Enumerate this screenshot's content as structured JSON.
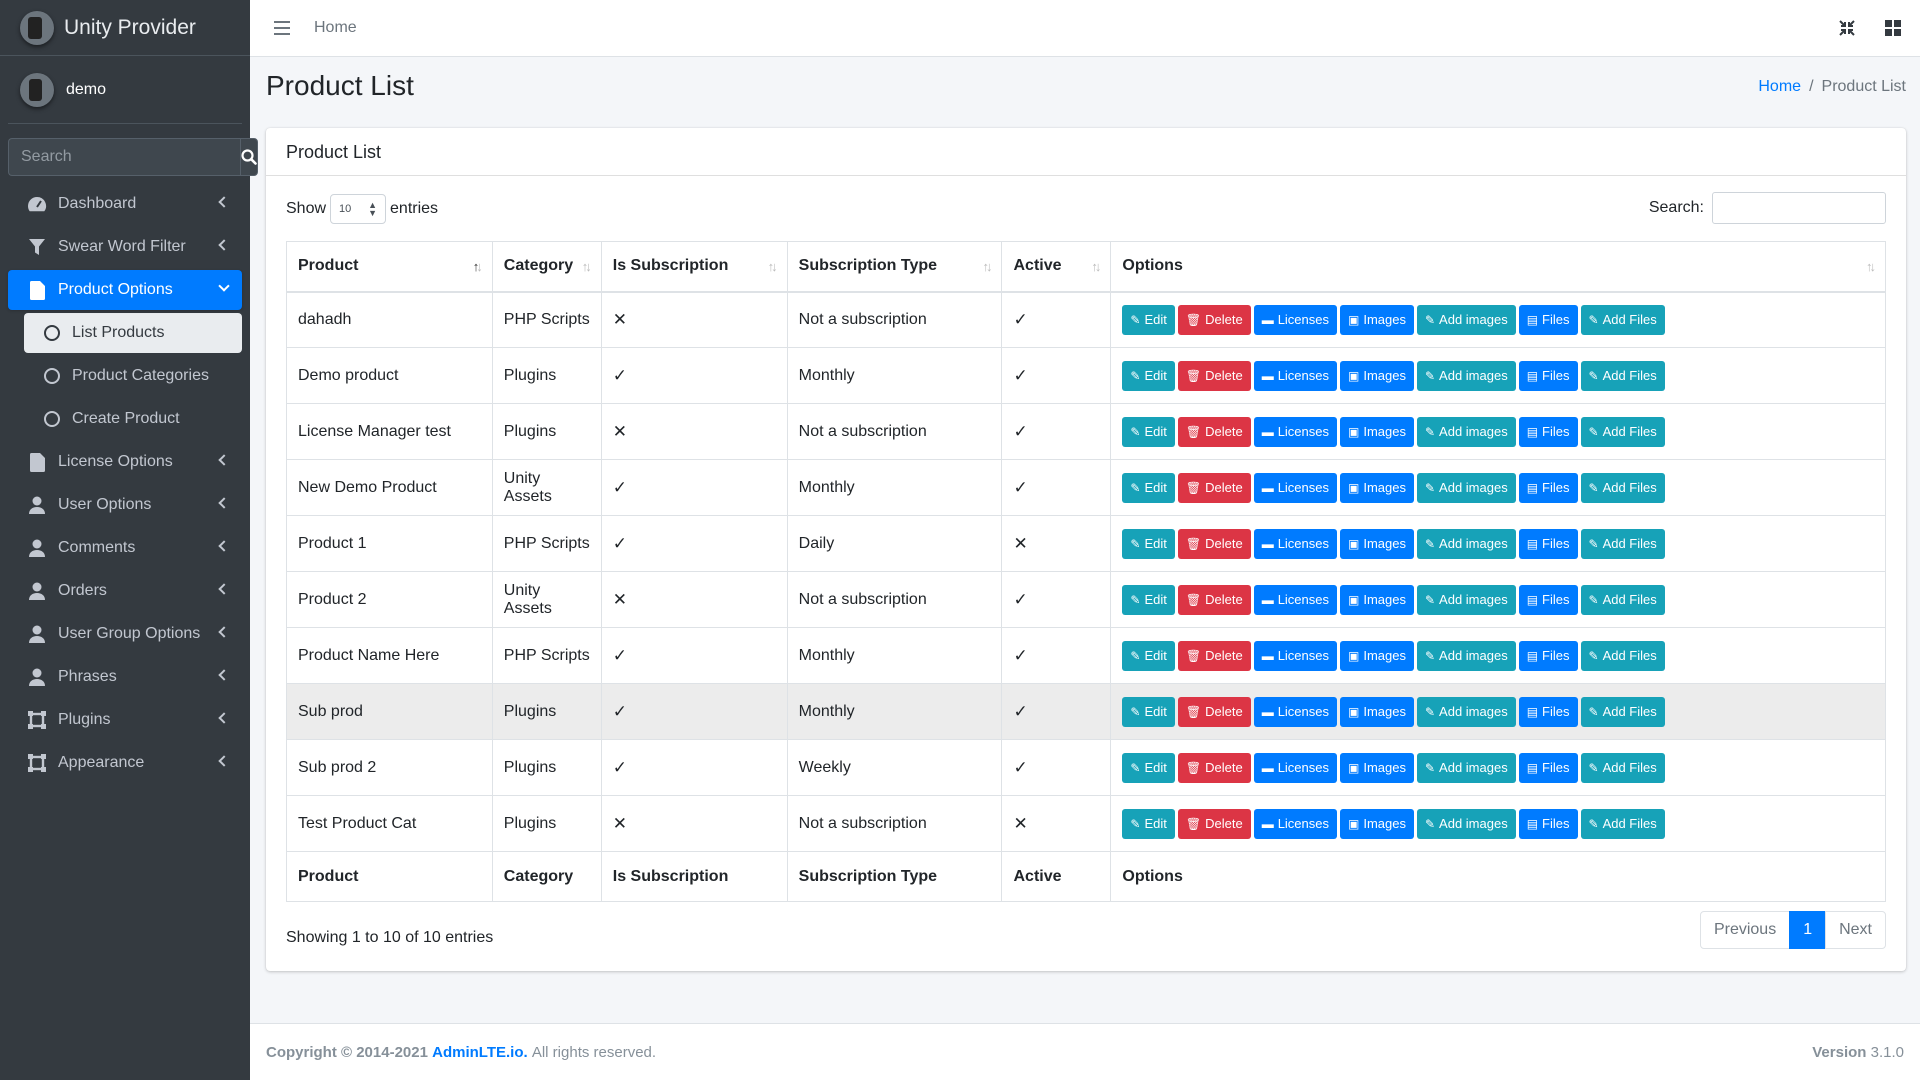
{
  "brand": {
    "name": "Unity Provider"
  },
  "user": {
    "name": "demo"
  },
  "sidebar_search": {
    "placeholder": "Search"
  },
  "nav": {
    "dashboard": "Dashboard",
    "swear_word_filter": "Swear Word Filter",
    "product_options": "Product Options",
    "list_products": "List Products",
    "product_categories": "Product Categories",
    "create_product": "Create Product",
    "license_options": "License Options",
    "user_options": "User Options",
    "comments": "Comments",
    "orders": "Orders",
    "user_group_options": "User Group Options",
    "phrases": "Phrases",
    "plugins": "Plugins",
    "appearance": "Appearance"
  },
  "topbar": {
    "home": "Home"
  },
  "header": {
    "title": "Product List",
    "breadcrumb_home": "Home",
    "breadcrumb_current": "Product List"
  },
  "card": {
    "title": "Product List"
  },
  "controls": {
    "show": "Show",
    "length": "10",
    "entries": "entries",
    "search_label": "Search:"
  },
  "columns": [
    "Product",
    "Category",
    "Is Subscription",
    "Subscription Type",
    "Active",
    "Options"
  ],
  "actions": {
    "edit": "Edit",
    "delete": "Delete",
    "licenses": "Licenses",
    "images": "Images",
    "add_images": "Add images",
    "files": "Files",
    "add_files": "Add Files"
  },
  "rows": [
    {
      "product": "dahadh",
      "category": "PHP Scripts",
      "is_subscription": "✕",
      "subscription_type": "Not a subscription",
      "active": "✓"
    },
    {
      "product": "Demo product",
      "category": "Plugins",
      "is_subscription": "✓",
      "subscription_type": "Monthly",
      "active": "✓"
    },
    {
      "product": "License Manager test",
      "category": "Plugins",
      "is_subscription": "✕",
      "subscription_type": "Not a subscription",
      "active": "✓"
    },
    {
      "product": "New Demo Product",
      "category": "Unity Assets",
      "is_subscription": "✓",
      "subscription_type": "Monthly",
      "active": "✓"
    },
    {
      "product": "Product 1",
      "category": "PHP Scripts",
      "is_subscription": "✓",
      "subscription_type": "Daily",
      "active": "✕"
    },
    {
      "product": "Product 2",
      "category": "Unity Assets",
      "is_subscription": "✕",
      "subscription_type": "Not a subscription",
      "active": "✓"
    },
    {
      "product": "Product Name Here",
      "category": "PHP Scripts",
      "is_subscription": "✓",
      "subscription_type": "Monthly",
      "active": "✓"
    },
    {
      "product": "Sub prod",
      "category": "Plugins",
      "is_subscription": "✓",
      "subscription_type": "Monthly",
      "active": "✓"
    },
    {
      "product": "Sub prod 2",
      "category": "Plugins",
      "is_subscription": "✓",
      "subscription_type": "Weekly",
      "active": "✓"
    },
    {
      "product": "Test Product Cat",
      "category": "Plugins",
      "is_subscription": "✕",
      "subscription_type": "Not a subscription",
      "active": "✕"
    }
  ],
  "table_info": "Showing 1 to 10 of 10 entries",
  "pagination": {
    "previous": "Previous",
    "current": "1",
    "next": "Next"
  },
  "footer": {
    "copyright": "Copyright © 2014-2021",
    "link": "AdminLTE.io.",
    "rights": "All rights reserved.",
    "version_label": "Version",
    "version": "3.1.0"
  },
  "colors": {
    "sidebar": "#343a40",
    "primary": "#007bff",
    "info": "#17a2b8",
    "danger": "#dc3545"
  }
}
